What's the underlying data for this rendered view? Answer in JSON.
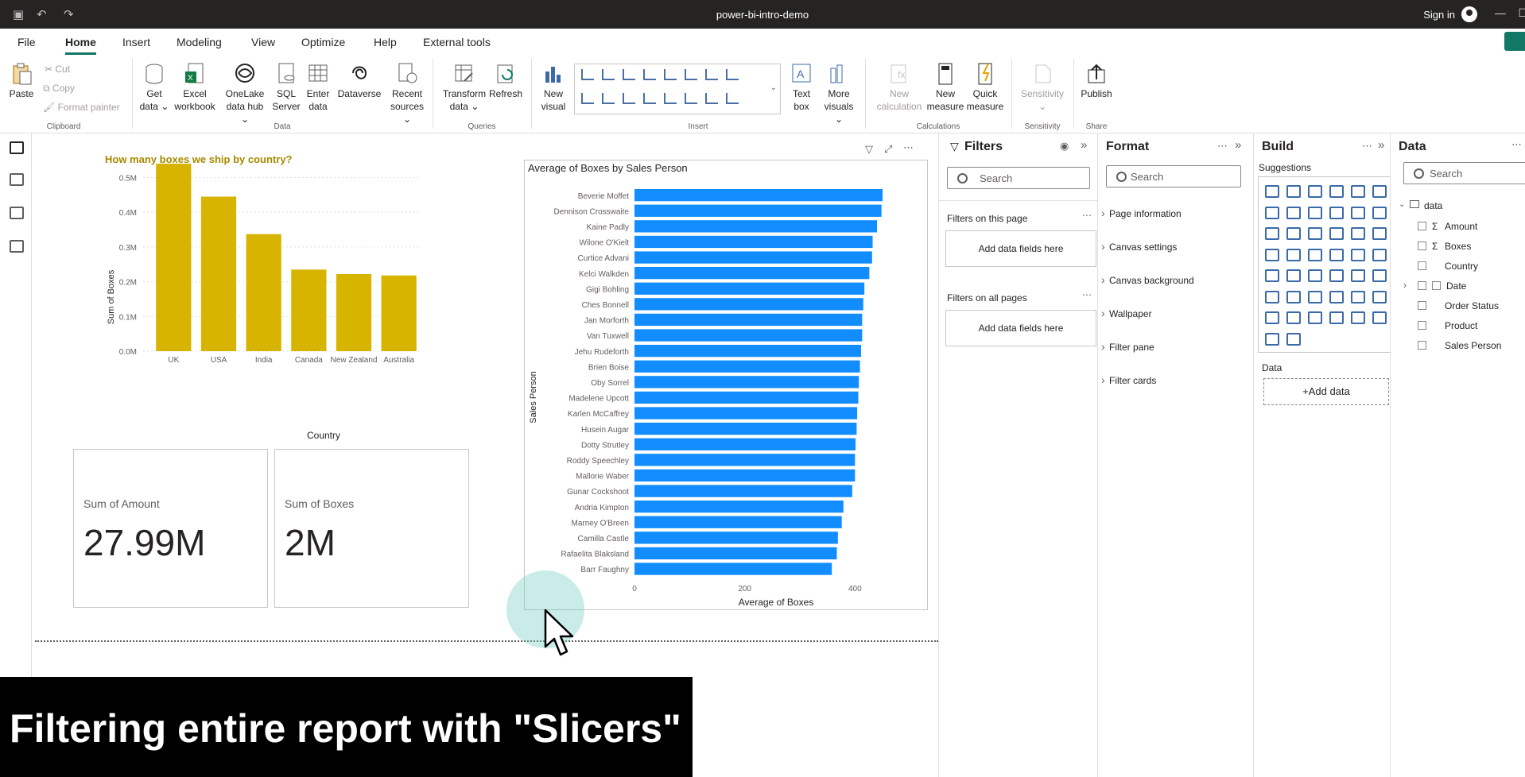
{
  "app": {
    "title": "power-bi-intro-demo",
    "sign_in": "Sign in"
  },
  "menu": {
    "tabs": [
      "File",
      "Home",
      "Insert",
      "Modeling",
      "View",
      "Optimize",
      "Help",
      "External tools"
    ],
    "active": "Home"
  },
  "ribbon": {
    "paste": "Paste",
    "cut": "Cut",
    "copy": "Copy",
    "format_painter": "Format painter",
    "clipboard": "Clipboard",
    "get_data_1": "Get",
    "get_data_2": "data ⌄",
    "excel_1": "Excel",
    "excel_2": "workbook",
    "onelake_1": "OneLake",
    "onelake_2": "data hub ⌄",
    "sql_1": "SQL",
    "sql_2": "Server",
    "enter_1": "Enter",
    "enter_2": "data",
    "dataverse": "Dataverse",
    "recent_1": "Recent",
    "recent_2": "sources ⌄",
    "data_group": "Data",
    "transform_1": "Transform",
    "transform_2": "data ⌄",
    "refresh": "Refresh",
    "queries_group": "Queries",
    "new_visual_1": "New",
    "new_visual_2": "visual",
    "text_box_1": "Text",
    "text_box_2": "box",
    "more_visuals_1": "More",
    "more_visuals_2": "visuals ⌄",
    "insert_group": "Insert",
    "new_calc_1": "New",
    "new_calc_2": "calculation",
    "new_measure_1": "New",
    "new_measure_2": "measure",
    "quick_measure_1": "Quick",
    "quick_measure_2": "measure",
    "calc_group": "Calculations",
    "sensitivity_1": "Sensitivity",
    "sensitivity_2": "⌄",
    "sensitivity_group": "Sensitivity",
    "publish": "Publish",
    "share_group": "Share"
  },
  "colors": {
    "accent": "#117865",
    "bar_gold": "#D6B400",
    "bar_blue": "#118DFF",
    "title_gold": "#A68A00"
  },
  "chart_data": [
    {
      "type": "bar",
      "title": "How many boxes we ship by country?",
      "xlabel": "Country",
      "ylabel": "Sum of Boxes",
      "categories": [
        "UK",
        "USA",
        "India",
        "Canada",
        "New Zealand",
        "Australia"
      ],
      "values": [
        540000,
        445000,
        337000,
        235000,
        222000,
        218000
      ],
      "ylim": [
        0,
        540000
      ],
      "y_ticks": [
        0,
        100000,
        200000,
        300000,
        400000,
        500000
      ],
      "y_tick_labels": [
        "0.0M",
        "0.1M",
        "0.2M",
        "0.3M",
        "0.4M",
        "0.5M"
      ],
      "grid": true
    },
    {
      "type": "bar",
      "orientation": "horizontal",
      "title": "Average of Boxes by Sales Person",
      "xlabel": "Average of Boxes",
      "ylabel": "Sales Person",
      "categories": [
        "Beverie Moffet",
        "Dennison Crosswaite",
        "Kaine Padly",
        "Wilone O'Kielt",
        "Curtice Advani",
        "Kelci Walkden",
        "Gigi Bohling",
        "Ches Bonnell",
        "Jan Morforth",
        "Van Tuxwell",
        "Jehu Rudeforth",
        "Brien Boise",
        "Oby Sorrel",
        "Madelene Upcott",
        "Karlen McCaffrey",
        "Husein Augar",
        "Dotty Strutley",
        "Roddy Speechley",
        "Mallorie Waber",
        "Gunar Cockshoot",
        "Andria Kimpton",
        "Marney O'Breen",
        "Camilla Castle",
        "Rafaelita Blaksland",
        "Barr Faughny"
      ],
      "values": [
        450,
        448,
        440,
        432,
        431,
        426,
        417,
        415,
        413,
        413,
        411,
        409,
        407,
        406,
        404,
        403,
        401,
        400,
        400,
        395,
        379,
        376,
        369,
        367,
        358
      ],
      "xlim": [
        0,
        450
      ],
      "x_ticks": [
        0,
        200,
        400
      ],
      "grid": false
    }
  ],
  "cards": [
    {
      "label": "Sum of Amount",
      "value": "27.99M"
    },
    {
      "label": "Sum of Boxes",
      "value": "2M"
    }
  ],
  "caption": "Filtering entire report with \"Slicers\"",
  "filters": {
    "title": "Filters",
    "search": "Search",
    "on_this_page": "Filters on this page",
    "on_all_pages": "Filters on all pages",
    "add_fields": "Add data fields here"
  },
  "format": {
    "title": "Format",
    "search": "Search",
    "sections": [
      "Page information",
      "Canvas settings",
      "Canvas background",
      "Wallpaper",
      "Filter pane",
      "Filter cards"
    ]
  },
  "build": {
    "title": "Build",
    "suggestions": "Suggestions",
    "data_label": "Data",
    "add_data": "+Add data"
  },
  "data": {
    "title": "Data",
    "search": "Search",
    "table": "data",
    "fields": [
      "Amount",
      "Boxes",
      "Country",
      "Date",
      "Order Status",
      "Product",
      "Sales Person"
    ]
  }
}
